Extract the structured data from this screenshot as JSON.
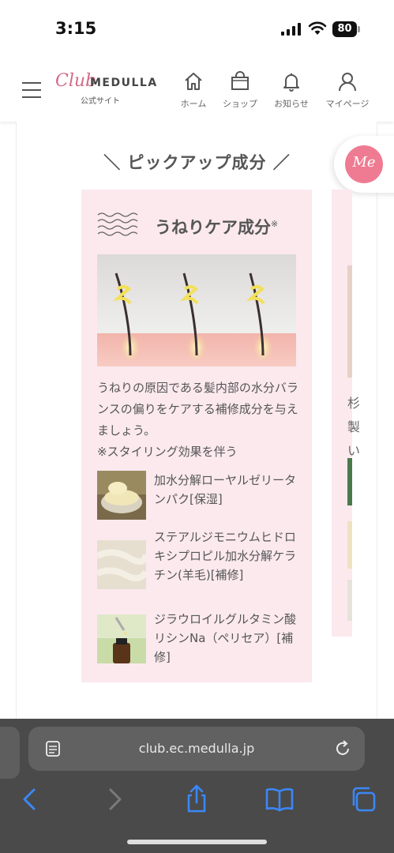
{
  "status": {
    "time": "3:15",
    "battery": "80"
  },
  "header": {
    "logo_script": "Club",
    "logo_brand": "MEDULLA",
    "logo_sub": "公式サイト",
    "nav": [
      {
        "label": "ホーム",
        "icon": "home-icon"
      },
      {
        "label": "ショップ",
        "icon": "shopping-bag-icon"
      },
      {
        "label": "お知らせ",
        "icon": "bell-icon"
      },
      {
        "label": "マイページ",
        "icon": "user-icon"
      }
    ]
  },
  "section_title": "＼ ピックアップ成分 ／",
  "me_button": "Me",
  "card": {
    "title": "うねりケア成分",
    "title_mark": "※",
    "description": "うねりの原因である髪内部の水分バランスの偏りをケアする補修成分を与えましょう。",
    "note": "※スタイリング効果を伴う",
    "ingredients": [
      {
        "name": "加水分解ローヤルゼリータンパク[保湿]"
      },
      {
        "name": "ステアルジモニウムヒドロキシプロピル加水分解ケラチン(羊毛)[補修]"
      },
      {
        "name": "ジラウロイルグルタミン酸リシンNa（ペリセア）[補修]"
      }
    ]
  },
  "card2_partial_text": "杉\n製\nい",
  "browser": {
    "url": "club.ec.medulla.jp"
  },
  "colors": {
    "accent": "#ef7b92",
    "card_bg": "#fbe9ee",
    "logo_pink": "#d46a8a"
  }
}
